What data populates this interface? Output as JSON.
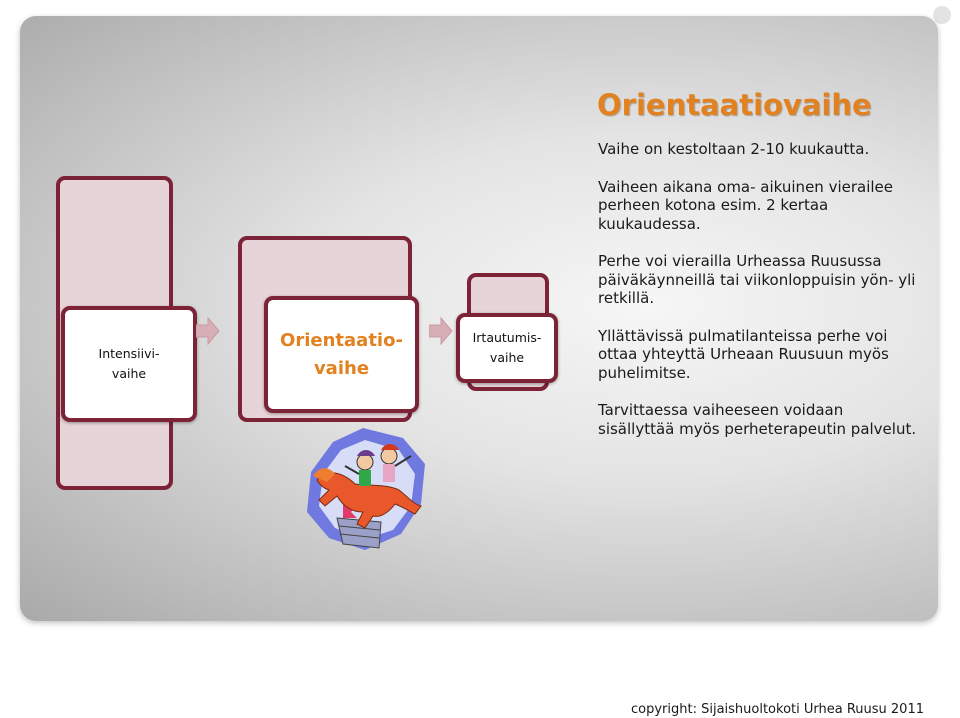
{
  "title": "Orientaatiovaihe",
  "paragraphs": [
    "Vaihe on kestoltaan 2-10 kuukautta.",
    "Vaiheen aikana oma- aikuinen vierailee perheen kotona esim. 2 kertaa kuukaudessa.",
    "Perhe voi vierailla Urheassa Ruusussa päiväkäynneillä tai viikonloppuisin yön- yli retkillä.",
    "Yllättävissä pulmatilanteissa perhe voi ottaa yhteyttä Urheaan Ruusuun myös puhelimitse.",
    "Tarvittaessa vaiheeseen voidaan sisällyttää myös perheterapeutin palvelut."
  ],
  "phases": [
    {
      "line1": "Intensiivi-",
      "line2": "vaihe"
    },
    {
      "line1": "Orientaatio-",
      "line2": "vaihe"
    },
    {
      "line1": "Irtautumis-",
      "line2": "vaihe"
    }
  ],
  "footer": "copyright: Sijaishuoltokoti Urhea Ruusu 2011",
  "colors": {
    "accent": "#e2811f",
    "border": "#7c2337",
    "back_fill": "#e7d4d8"
  },
  "illustration": "clipart-children-riding-horse-icon"
}
